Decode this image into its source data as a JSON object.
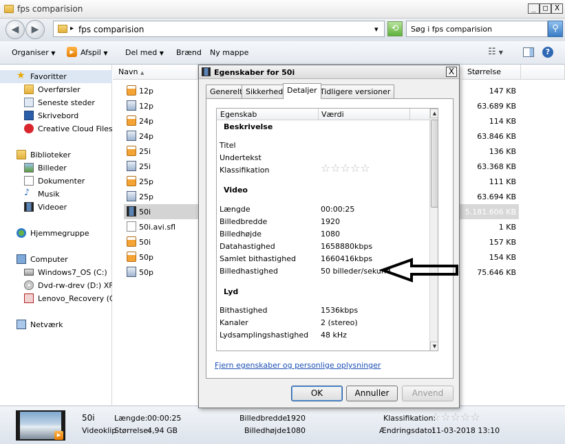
{
  "window": {
    "title": "fps comparision",
    "minimize": "_",
    "maximize": "□",
    "close": "X"
  },
  "address": {
    "path": "fps comparision",
    "sep": "▸",
    "dropdown": "▾"
  },
  "search": {
    "placeholder": "Søg i fps comparision"
  },
  "toolbar": {
    "organize": "Organiser",
    "play": "Afspil",
    "share": "Del med",
    "burn": "Brænd",
    "new_folder": "Ny mappe"
  },
  "nav": {
    "favorites": "Favoritter",
    "downloads": "Overførsler",
    "recent": "Seneste steder",
    "desktop": "Skrivebord",
    "cc": "Creative Cloud Files",
    "libraries": "Biblioteker",
    "pictures": "Billeder",
    "documents": "Dokumenter",
    "music": "Musik",
    "videos": "Videoer",
    "homegroup": "Hjemmegruppe",
    "computer": "Computer",
    "c": "Windows7_OS (C:)",
    "d": "Dvd-rw-drev (D:) XFIL",
    "q": "Lenovo_Recovery (Q:",
    "network": "Netværk"
  },
  "columns": {
    "name": "Navn",
    "size": "Størrelse"
  },
  "files": [
    {
      "name": "12p",
      "size": "147 KB",
      "kind": "vlc"
    },
    {
      "name": "12p",
      "size": "63.689 KB",
      "kind": "vid"
    },
    {
      "name": "24p",
      "size": "114 KB",
      "kind": "vlc"
    },
    {
      "name": "24p",
      "size": "63.846 KB",
      "kind": "vid"
    },
    {
      "name": "25i",
      "size": "136 KB",
      "kind": "vlc"
    },
    {
      "name": "25i",
      "size": "63.368 KB",
      "kind": "vid"
    },
    {
      "name": "25p",
      "size": "111 KB",
      "kind": "vlc"
    },
    {
      "name": "25p",
      "size": "63.694 KB",
      "kind": "vid"
    },
    {
      "name": "50i",
      "size": "5.181.606 KB",
      "kind": "film"
    },
    {
      "name": "50i.avi.sfl",
      "size": "1 KB",
      "kind": "doc"
    },
    {
      "name": "50i",
      "size": "157 KB",
      "kind": "vlc"
    },
    {
      "name": "50p",
      "size": "154 KB",
      "kind": "vlc"
    },
    {
      "name": "50p",
      "size": "75.646 KB",
      "kind": "vid"
    }
  ],
  "details": {
    "name": "50i",
    "type": "Videoklip",
    "length_label": "Længde:",
    "length": "00:00:25",
    "size_label": "Størrelse:",
    "size": "4,94 GB",
    "width_label": "Billedbredde:",
    "width": "1920",
    "height_label": "Billedhøjde:",
    "height": "1080",
    "rating_label": "Klassifikation:",
    "modified_label": "Ændringsdato:",
    "modified": "11-03-2018 13:10"
  },
  "dialog": {
    "title": "Egenskaber for 50i",
    "close": "X",
    "tabs": [
      "Generelt",
      "Sikkerhed",
      "Detaljer",
      "Tidligere versioner"
    ],
    "col_property": "Egenskab",
    "col_value": "Værdi",
    "sections": {
      "description": "Beskrivelse",
      "video": "Video",
      "audio": "Lyd"
    },
    "description": {
      "title": "Titel",
      "subtitle": "Undertekst",
      "rating": "Klassifikation"
    },
    "video": {
      "length_k": "Længde",
      "length_v": "00:00:25",
      "width_k": "Billedbredde",
      "width_v": "1920",
      "height_k": "Billedhøjde",
      "height_v": "1080",
      "datarate_k": "Datahastighed",
      "datarate_v": "1658880kbps",
      "totalbitrate_k": "Samlet bithastighed",
      "totalbitrate_v": "1660416kbps",
      "framerate_k": "Billedhastighed",
      "framerate_v": "50 billeder/sekund"
    },
    "audio": {
      "bitrate_k": "Bithastighed",
      "bitrate_v": "1536kbps",
      "channels_k": "Kanaler",
      "channels_v": "2 (stereo)",
      "samplerate_k": "Lydsamplingshastighed",
      "samplerate_v": "48 kHz"
    },
    "link": "Fjern egenskaber og personlige oplysninger",
    "ok": "OK",
    "cancel": "Annuller",
    "apply": "Anvend"
  },
  "colors": {
    "accent": "#3a7cc6",
    "selection": "#d4d4d4",
    "link": "#1a4fb5"
  }
}
